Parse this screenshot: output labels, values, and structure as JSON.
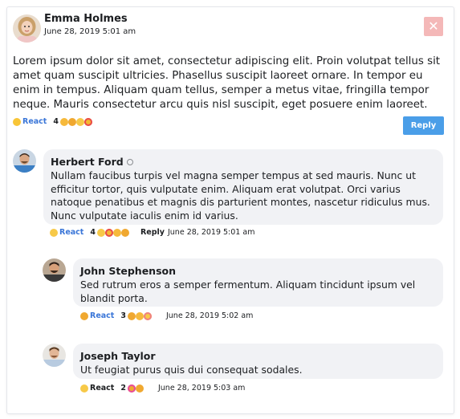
{
  "post": {
    "author": "Emma Holmes",
    "date": "June 28, 2019 5:01 am",
    "text": "Lorem ipsum dolor sit amet, consectetur adipiscing elit. Proin volutpat tellus sit amet quam suscipit ultricies. Phasellus suscipit laoreet ornare. In tempor eu enim in tempus. Aliquam quam tellus, semper a metus vitae, fringilla tempor neque. Mauris consectetur arcu quis nisl suscipit, eget posuere enim laoreet.",
    "react_label": "React",
    "reaction_count": "4",
    "reactions": [
      "wink",
      "hug",
      "grin",
      "heart-eyes"
    ],
    "reply_button": "Reply",
    "close_icon": "close-icon"
  },
  "comments": [
    {
      "author": "Herbert Ford",
      "text": "Nullam faucibus turpis vel magna semper tempus at sed mauris. Nunc ut efficitur tortor, quis vulputate enim. Aliquam erat volutpat. Orci varius natoque penatibus et magnis dis parturient montes, nascetur ridiculus mus. Nunc vulputate iaculis enim id varius.",
      "react_label": "React",
      "reaction_count": "4",
      "reactions": [
        "grin",
        "heart-eyes",
        "laugh",
        "hug"
      ],
      "reply_label": "Reply",
      "date": "June 28, 2019 5:01 am"
    },
    {
      "author": "John Stephenson",
      "text": "Sed rutrum eros a semper fermentum. Aliquam tincidunt ipsum vel blandit porta.",
      "react_label": "React",
      "reaction_count": "3",
      "reactions": [
        "hug",
        "wink",
        "blush"
      ],
      "date": "June 28, 2019 5:02 am"
    },
    {
      "author": "Joseph Taylor",
      "text": "Ut feugiat purus quis dui consequat sodales.",
      "react_label": "React",
      "reaction_count": "2",
      "reactions": [
        "party",
        "hug"
      ],
      "date": "June 28, 2019 5:03 am"
    }
  ],
  "colors": {
    "accent": "#4a9ee8",
    "link_blue": "#3a76d8",
    "bubble_bg": "#f1f2f5",
    "close_bg": "#f4b8b8"
  }
}
